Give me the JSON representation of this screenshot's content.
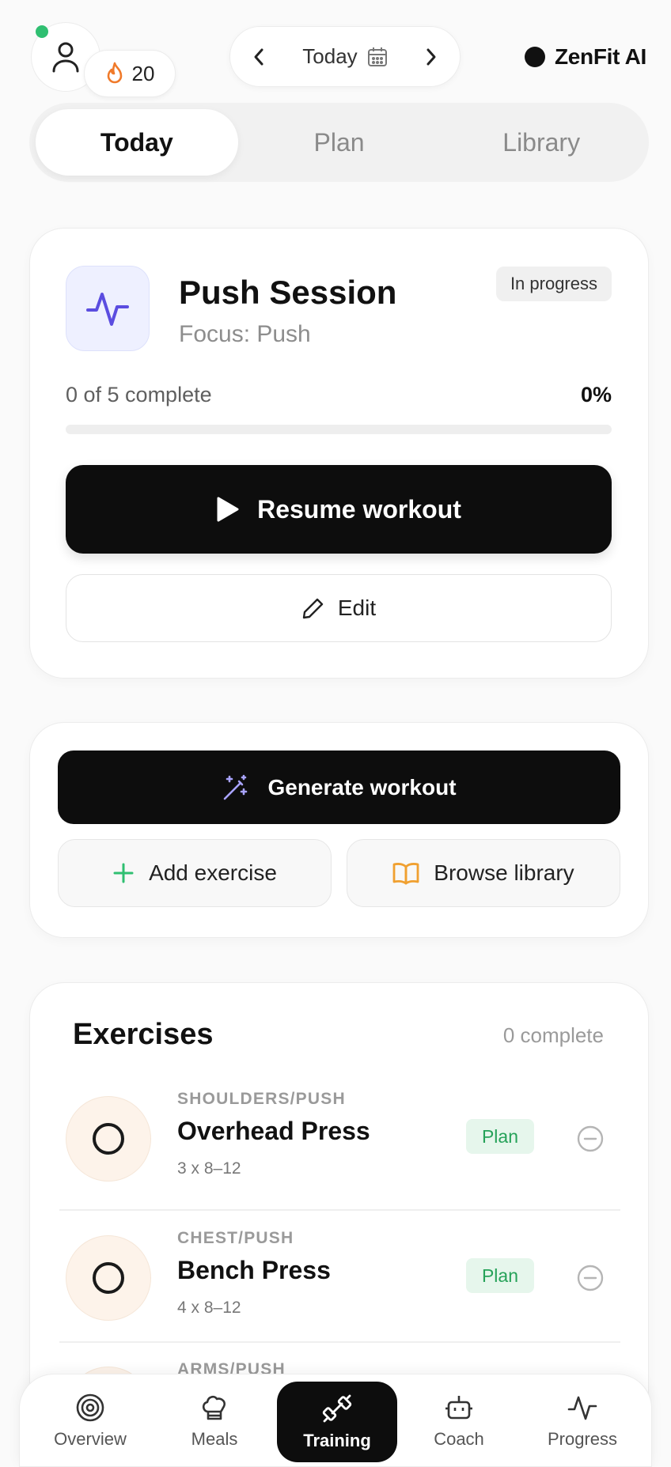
{
  "header": {
    "streak_count": "20",
    "date_label": "Today",
    "brand_name": "ZenFit AI",
    "icons": {
      "avatar": "user-icon",
      "streak": "flame-icon",
      "prev": "chevron-left-icon",
      "next": "chevron-right-icon",
      "calendar": "calendar-icon"
    }
  },
  "tabs": [
    {
      "label": "Today",
      "active": true
    },
    {
      "label": "Plan",
      "active": false
    },
    {
      "label": "Library",
      "active": false
    }
  ],
  "session": {
    "title": "Push Session",
    "focus": "Focus: Push",
    "status": "In progress",
    "progress_text": "0 of 5 complete",
    "progress_percent_label": "0%",
    "progress_fraction": 0,
    "resume_label": "Resume workout",
    "edit_label": "Edit"
  },
  "actions": {
    "generate_label": "Generate workout",
    "add_exercise_label": "Add exercise",
    "browse_library_label": "Browse library"
  },
  "exercises": {
    "heading": "Exercises",
    "complete_count": "0 complete",
    "items": [
      {
        "category": "SHOULDERS/PUSH",
        "name": "Overhead Press",
        "sets": "3 x 8–12",
        "badge": "Plan"
      },
      {
        "category": "CHEST/PUSH",
        "name": "Bench Press",
        "sets": "4 x 8–12",
        "badge": "Plan"
      },
      {
        "category": "ARMS/PUSH",
        "name": "",
        "sets": "",
        "badge": ""
      }
    ]
  },
  "nav": {
    "items": [
      {
        "label": "Overview",
        "icon": "target-icon"
      },
      {
        "label": "Meals",
        "icon": "chef-hat-icon"
      },
      {
        "label": "Training",
        "icon": "dumbbell-icon",
        "active": true
      },
      {
        "label": "Coach",
        "icon": "robot-icon"
      },
      {
        "label": "Progress",
        "icon": "activity-icon"
      }
    ]
  },
  "colors": {
    "accent_dark": "#0d0d0d",
    "online_green": "#2fbf71",
    "flame_orange": "#f07a2a",
    "session_icon_purple": "#5b4de0",
    "plan_green": "#26a259",
    "add_green": "#2fbf71",
    "library_orange": "#f0a030"
  }
}
